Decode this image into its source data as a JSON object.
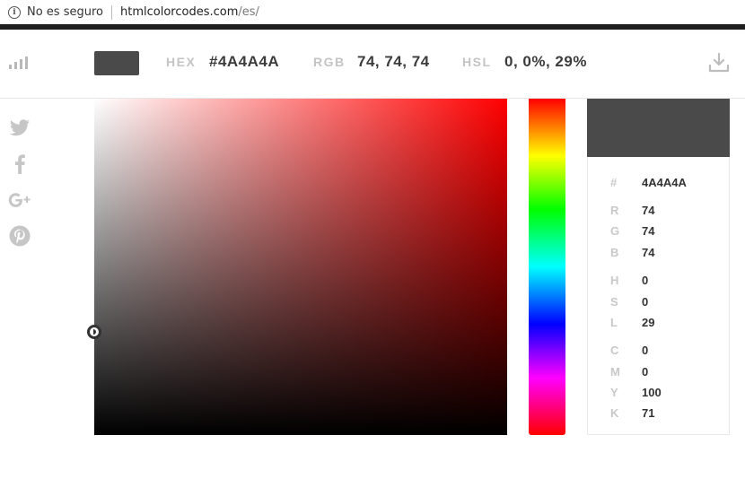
{
  "browser": {
    "security_text": "No es seguro",
    "domain": "htmlcolorcodes.com",
    "path": "/es/"
  },
  "colors": {
    "selected": "#4A4A4A",
    "hue_base": "#FF0000"
  },
  "toolbar": {
    "hex_label": "HEX",
    "hex_value": "#4A4A4A",
    "rgb_label": "RGB",
    "rgb_value": "74, 74, 74",
    "hsl_label": "HSL",
    "hsl_value": "0, 0%, 29%",
    "left_icon": "stats-icon",
    "right_icon": "download-icon"
  },
  "social": [
    "twitter-icon",
    "facebook-icon",
    "google-plus-icon",
    "pinterest-icon"
  ],
  "panel": {
    "rows": [
      {
        "k": "#",
        "v": "4A4A4A"
      },
      {
        "k": "R",
        "v": "74"
      },
      {
        "k": "G",
        "v": "74"
      },
      {
        "k": "B",
        "v": "74"
      },
      {
        "k": "H",
        "v": "0"
      },
      {
        "k": "S",
        "v": "0"
      },
      {
        "k": "L",
        "v": "29"
      },
      {
        "k": "C",
        "v": "0"
      },
      {
        "k": "M",
        "v": "0"
      },
      {
        "k": "Y",
        "v": "100"
      },
      {
        "k": "K",
        "v": "71"
      }
    ]
  }
}
